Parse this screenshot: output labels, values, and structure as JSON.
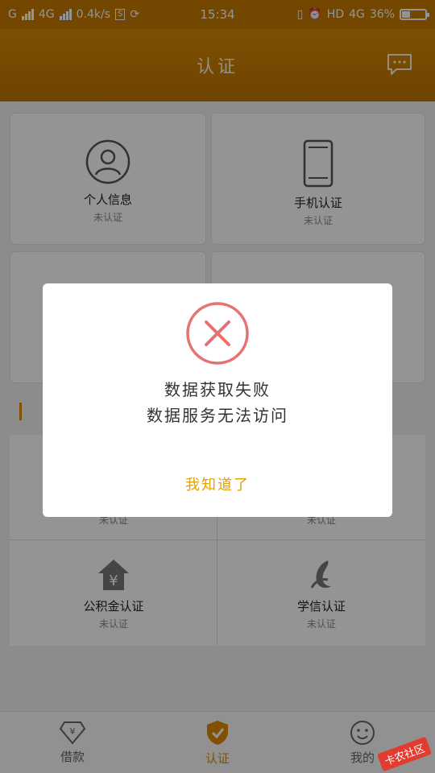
{
  "status_bar": {
    "carrier1": "G",
    "net_type": "4G",
    "speed": "0.4k/s",
    "time": "15:34",
    "hd_label": "HD",
    "net_type2": "4G",
    "battery_text": "36%",
    "battery_level": 0.36
  },
  "header": {
    "title": "认证",
    "message_icon": "message-icon"
  },
  "cards": [
    {
      "title": "个人信息",
      "status": "未认证",
      "icon": "person-icon"
    },
    {
      "title": "手机认证",
      "status": "未认证",
      "icon": "phone-icon"
    }
  ],
  "grid_top_status": [
    "未认证",
    "未认证"
  ],
  "grid_bottom": [
    {
      "title": "公积金认证",
      "status": "未认证",
      "icon": "house-fund-icon"
    },
    {
      "title": "学信认证",
      "status": "未认证",
      "icon": "education-icon"
    }
  ],
  "dialog": {
    "line1": "数据获取失败",
    "line2": "数据服务无法访问",
    "ok_label": "我知道了",
    "icon": "error-x-icon"
  },
  "tabs": [
    {
      "label": "借款",
      "icon": "diamond-yen-icon",
      "active": false
    },
    {
      "label": "认证",
      "icon": "shield-check-icon",
      "active": true
    },
    {
      "label": "我的",
      "icon": "smile-icon",
      "active": false
    }
  ],
  "watermark": "卡农社区",
  "colors": {
    "accent": "#e08a00",
    "header": "#c77a00",
    "dialog_button": "#e5a000",
    "error": "#e57373"
  }
}
